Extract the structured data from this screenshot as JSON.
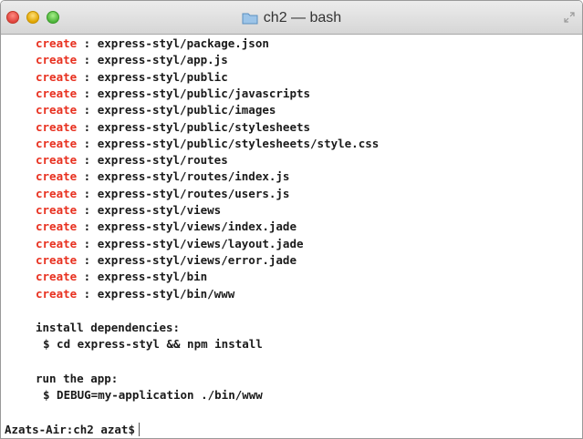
{
  "window": {
    "title": "ch2 — bash"
  },
  "terminal": {
    "create_keyword": "create",
    "create_lines": [
      "express-styl/package.json",
      "express-styl/app.js",
      "express-styl/public",
      "express-styl/public/javascripts",
      "express-styl/public/images",
      "express-styl/public/stylesheets",
      "express-styl/public/stylesheets/style.css",
      "express-styl/routes",
      "express-styl/routes/index.js",
      "express-styl/routes/users.js",
      "express-styl/views",
      "express-styl/views/index.jade",
      "express-styl/views/layout.jade",
      "express-styl/views/error.jade",
      "express-styl/bin",
      "express-styl/bin/www"
    ],
    "install_heading": "install dependencies:",
    "install_command": "$ cd express-styl && npm install",
    "run_heading": "run the app:",
    "run_command": "$ DEBUG=my-application ./bin/www",
    "prompt": "Azats-Air:ch2 azat$"
  },
  "colors": {
    "create_keyword": "#e8301f",
    "text": "#1a1a1a"
  }
}
